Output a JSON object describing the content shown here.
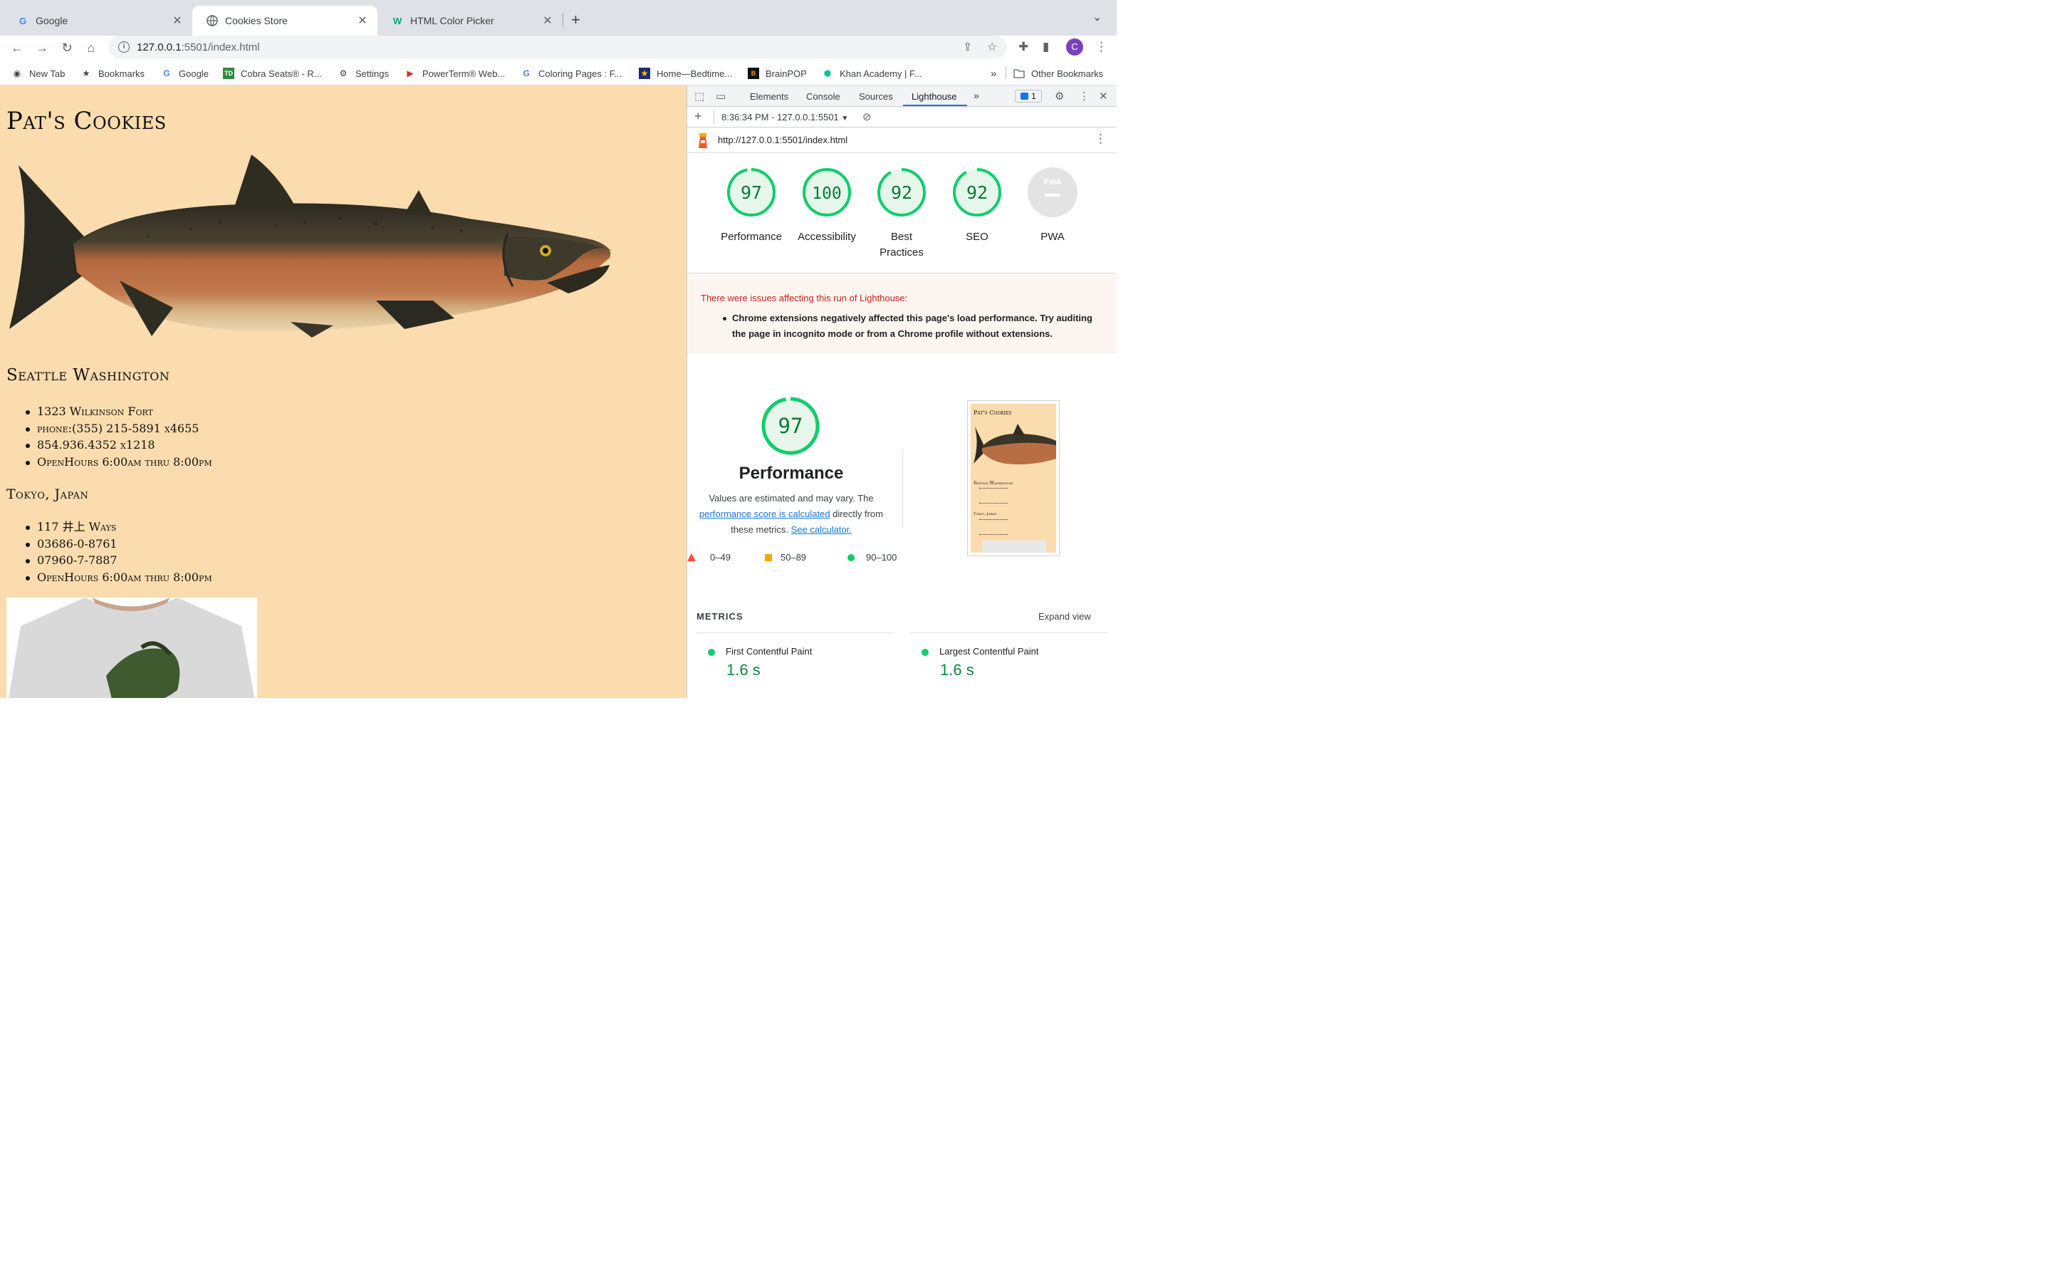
{
  "tabs": [
    {
      "title": "Google",
      "icon": "google-favicon",
      "active": false
    },
    {
      "title": "Cookies Store",
      "icon": "globe-favicon",
      "active": true
    },
    {
      "title": "HTML Color Picker",
      "icon": "w3schools-favicon",
      "active": false
    }
  ],
  "address": {
    "host": "127.0.0.1",
    "path": ":5501/index.html"
  },
  "bookmarks": [
    {
      "label": "New Tab",
      "icon": "camera-icon"
    },
    {
      "label": "Bookmarks",
      "icon": "star-icon"
    },
    {
      "label": "Google",
      "icon": "google-favicon"
    },
    {
      "label": "Cobra Seats® - R...",
      "icon": "td-favicon"
    },
    {
      "label": "Settings",
      "icon": "gear-icon"
    },
    {
      "label": "PowerTerm® Web...",
      "icon": "powerterm-favicon"
    },
    {
      "label": "Coloring Pages : F...",
      "icon": "google-favicon"
    },
    {
      "label": "Home—Bedtime...",
      "icon": "star-badge-favicon"
    },
    {
      "label": "BrainPOP",
      "icon": "brainpop-favicon"
    },
    {
      "label": "Khan Academy | F...",
      "icon": "khan-favicon"
    }
  ],
  "bookmarks_overflow": "»",
  "other_bookmarks": "Other Bookmarks",
  "page": {
    "title": "Pat's Cookies",
    "seattle": {
      "heading": "Seattle Washington",
      "items": [
        "1323 Wilkinson Fort",
        "phone:(355) 215-5891 x4655",
        "854.936.4352 x1218",
        "OpenHours 6:00am thru 8:00pm"
      ]
    },
    "tokyo": {
      "heading": "Tokyo, Japan",
      "items": [
        "117 井上 Ways",
        "03686-0-8761",
        "07960-7-7887",
        "OpenHours 6:00am thru 8:00pm"
      ]
    }
  },
  "devtools": {
    "tabs": [
      "Elements",
      "Console",
      "Sources",
      "Lighthouse"
    ],
    "more": "»",
    "message_count": "1",
    "report_time": "8:36:34 PM - 127.0.0.1:5501",
    "report_url": "http://127.0.0.1:5501/index.html",
    "scores": [
      {
        "value": "97",
        "label": "Performance"
      },
      {
        "value": "100",
        "label": "Accessibility"
      },
      {
        "value": "92",
        "label": "Best Practices"
      },
      {
        "value": "92",
        "label": "SEO"
      },
      {
        "value": "PWA",
        "label": "PWA"
      }
    ],
    "issues_head": "There were issues affecting this run of Lighthouse:",
    "issues_item": "Chrome extensions negatively affected this page's load performance. Try auditing the page in incognito mode or from a Chrome profile without extensions.",
    "perf_score": "97",
    "perf_title": "Performance",
    "perf_desc_1": "Values are estimated and may vary. The",
    "perf_link_1": "performance score is calculated",
    "perf_desc_2": "directly from these metrics.",
    "perf_link_2": "See calculator.",
    "legend": [
      "0–49",
      "50–89",
      "90–100"
    ],
    "thumb": {
      "title": "Pat's Cookies",
      "h2": "Seattle Washington",
      "h3": "Tokyo, Japan"
    },
    "metrics_head": "METRICS",
    "expand": "Expand view",
    "metrics": [
      {
        "name": "First Contentful Paint",
        "value": "1.6 s"
      },
      {
        "name": "Largest Contentful Paint",
        "value": "1.6 s"
      }
    ]
  },
  "colors": {
    "good": "#0cce6b",
    "page_bg": "#fadcae",
    "accent": "#1a73e8"
  }
}
